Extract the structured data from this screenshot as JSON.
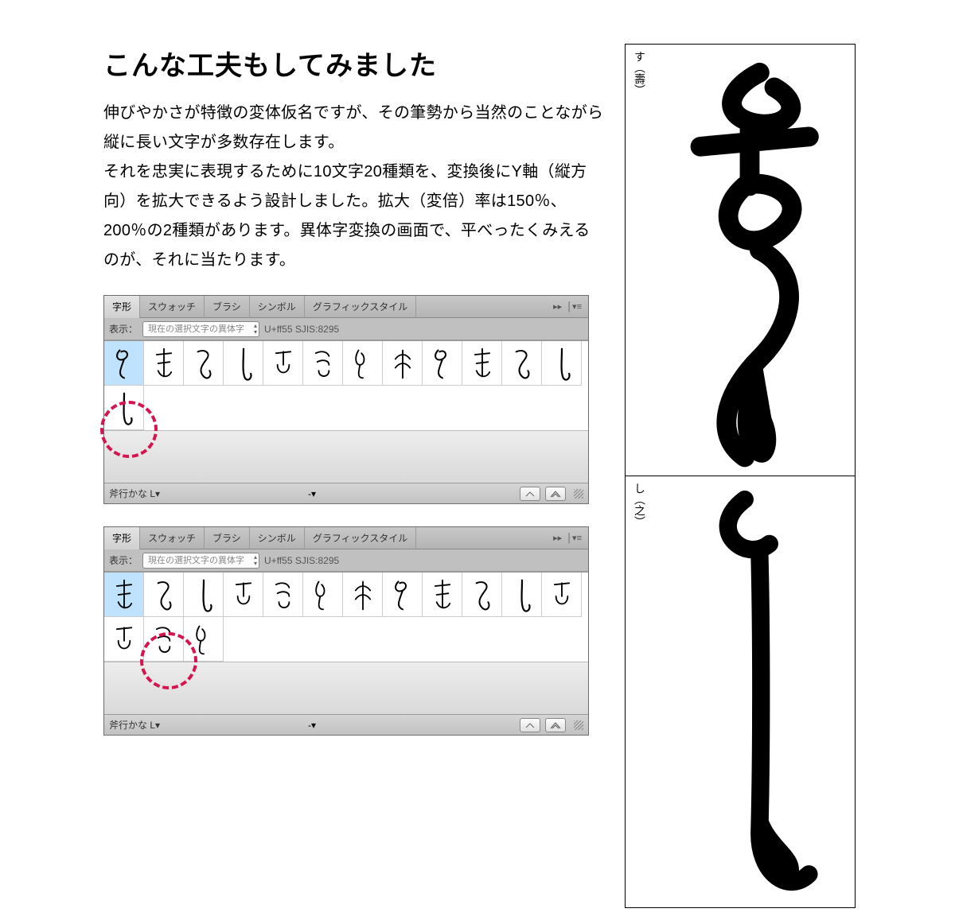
{
  "heading": "こんな工夫もしてみました",
  "body": "伸びやかさが特徴の変体仮名ですが、その筆勢から当然のことながら縦に長い文字が多数存在します。\nそれを忠実に表現するために10文字20種類を、変換後にY軸（縦方向）を拡大できるよう設計しました。拡大（変倍）率は150％、200％の2種類があります。異体字変換の画面で、平べったくみえるのが、それに当たります。",
  "panels": [
    {
      "tabs": [
        "字形",
        "スウォッチ",
        "ブラシ",
        "シンボル",
        "グラフィックスタイル"
      ],
      "active_tab": 0,
      "show_label": "表示：",
      "show_select": "現在の選択文字の異体字",
      "unicode": "U+ff55 SJIS:8295",
      "font": "斧行かな L",
      "highlight_cell": 12,
      "row1_glyphs": [
        "す",
        "寿",
        "寸",
        "数",
        "あ",
        "あ",
        "須",
        "ほ",
        "ほ",
        "す",
        "寿",
        "寿"
      ],
      "row2_glyphs": [
        "寿"
      ]
    },
    {
      "tabs": [
        "字形",
        "スウォッチ",
        "ブラシ",
        "シンボル",
        "グラフィックスタイル"
      ],
      "active_tab": 0,
      "show_label": "表示：",
      "show_select": "現在の選択文字の異体字",
      "unicode": "U+ff55 SJIS:8295",
      "font": "斧行かな L",
      "highlight_cell": 13,
      "row1_glyphs": [
        "し",
        "志",
        "志",
        "之",
        "之",
        "し",
        "新",
        "多",
        "四",
        "の",
        "四",
        "之"
      ],
      "row2_glyphs": [
        "之",
        "し",
        "み"
      ]
    }
  ],
  "samples": [
    {
      "label": "す（壽）"
    },
    {
      "label": "し（之）"
    }
  ]
}
